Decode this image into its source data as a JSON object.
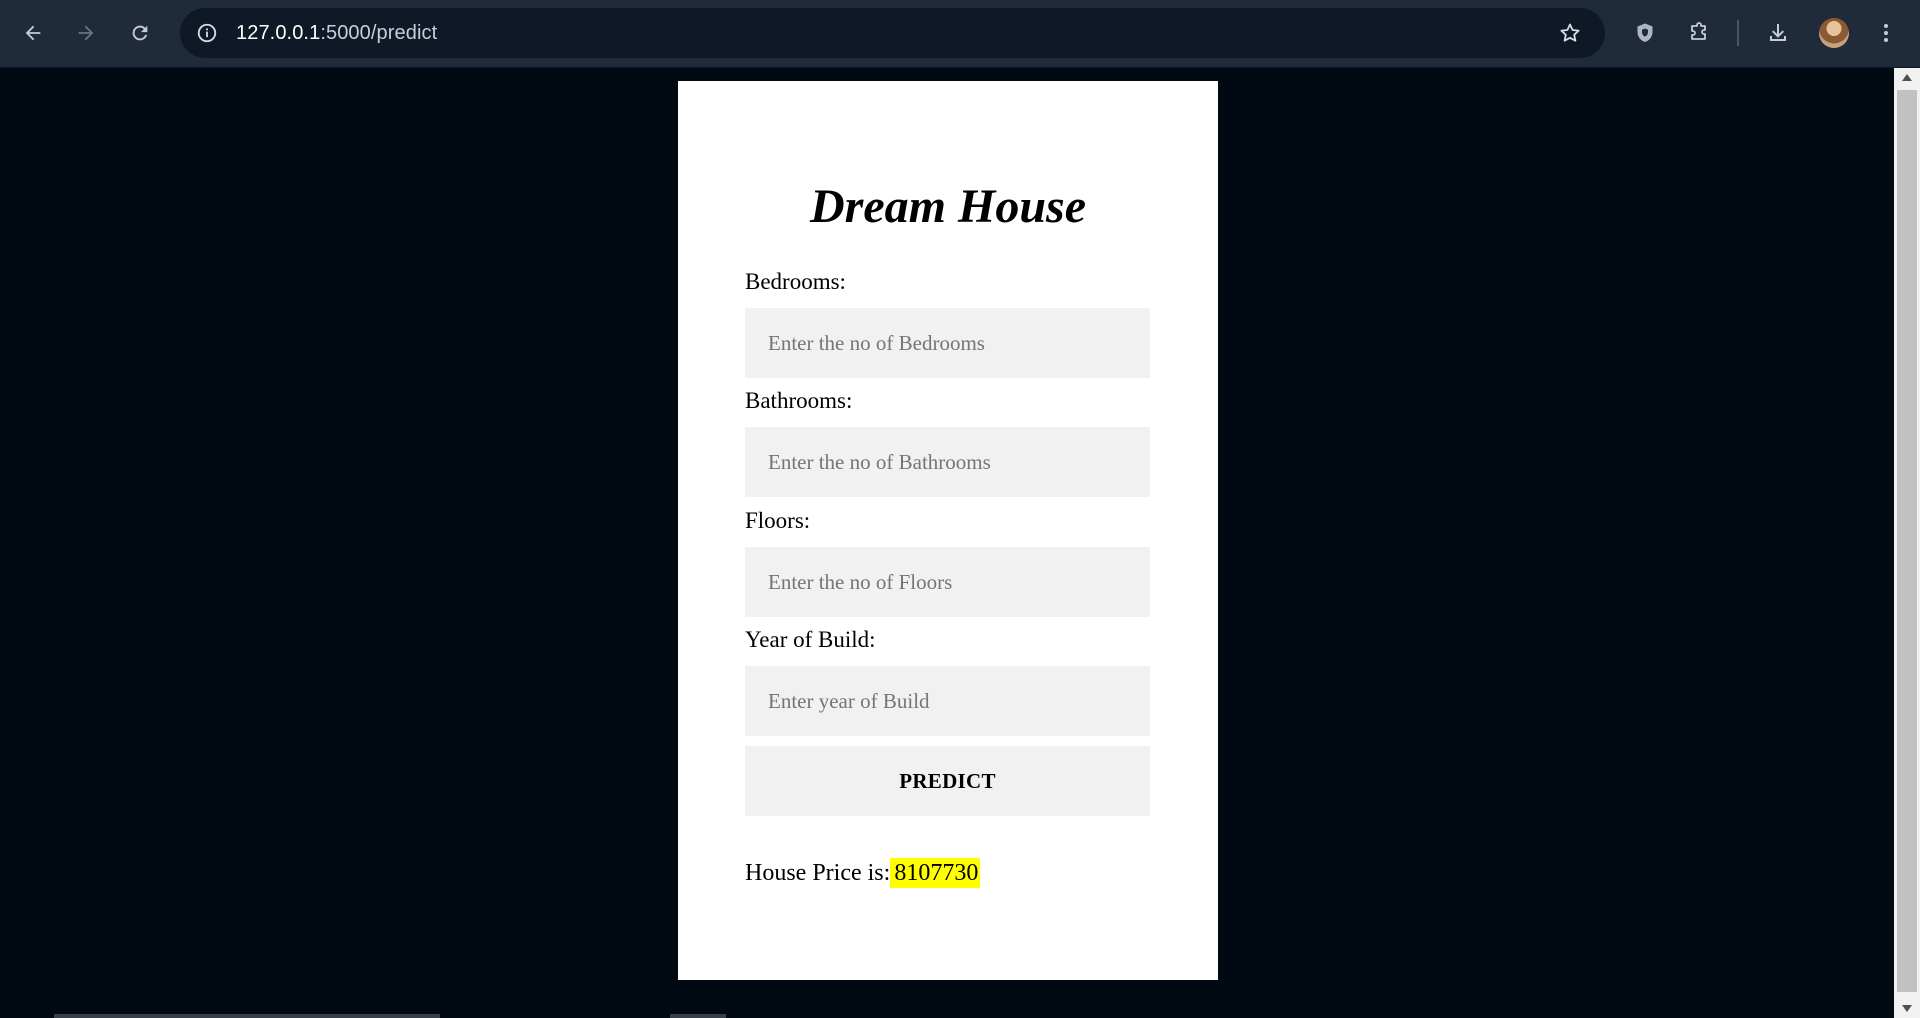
{
  "browser": {
    "url_host": "127.0.0.1",
    "url_path": ":5000/predict"
  },
  "page": {
    "title": "Dream House",
    "fields": [
      {
        "label": "Bedrooms:",
        "placeholder": "Enter the no of Bedrooms",
        "value": ""
      },
      {
        "label": "Bathrooms:",
        "placeholder": "Enter the no of Bathrooms",
        "value": ""
      },
      {
        "label": "Floors:",
        "placeholder": "Enter the no of Floors",
        "value": ""
      },
      {
        "label": "Year of Build:",
        "placeholder": "Enter year of Build",
        "value": ""
      }
    ],
    "predict_label": "PREDICT",
    "result_label": "House Price is:",
    "result_value": "8107730"
  },
  "colors": {
    "page_background": "#010a12",
    "card_background": "#ffffff",
    "input_background": "#f1f1f1",
    "highlight": "#ffff00",
    "chrome_background": "#1f2a3a"
  },
  "icons": {
    "back": "arrow-left-icon",
    "forward": "arrow-right-icon",
    "reload": "reload-icon",
    "site_info": "info-icon",
    "bookmark": "star-icon",
    "extension_shield": "shield-icon",
    "extensions": "puzzle-icon",
    "downloads": "download-icon",
    "menu": "kebab-menu-icon"
  }
}
